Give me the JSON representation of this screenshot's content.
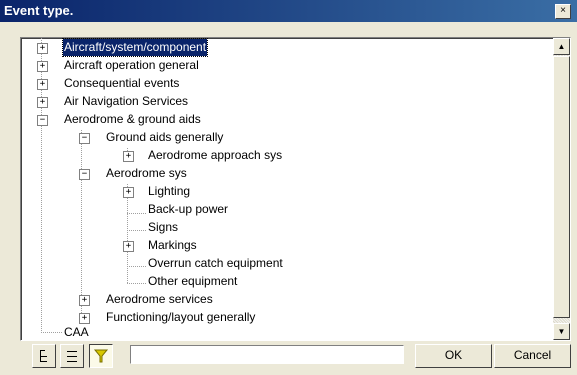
{
  "window": {
    "title": "Event type.",
    "close_glyph": "×"
  },
  "tree": {
    "nodes": [
      {
        "label": "Aircraft/system/component",
        "expander": "+",
        "selected": true
      },
      {
        "label": "Aircraft operation general",
        "expander": "+"
      },
      {
        "label": "Consequential events",
        "expander": "+"
      },
      {
        "label": "Air Navigation Services",
        "expander": "+"
      },
      {
        "label": "Aerodrome & ground aids",
        "expander": "−"
      },
      {
        "label": "Ground aids generally",
        "expander": "−"
      },
      {
        "label": "Aerodrome approach sys",
        "expander": "+"
      },
      {
        "label": "Aerodrome sys",
        "expander": "−"
      },
      {
        "label": "Lighting",
        "expander": "+"
      },
      {
        "label": "Back-up power",
        "expander": ""
      },
      {
        "label": "Signs",
        "expander": ""
      },
      {
        "label": "Markings",
        "expander": "+"
      },
      {
        "label": "Overrun catch equipment",
        "expander": ""
      },
      {
        "label": "Other equipment",
        "expander": ""
      },
      {
        "label": "Aerodrome services",
        "expander": "+"
      },
      {
        "label": "Functioning/layout generally",
        "expander": "+"
      },
      {
        "label": "CAA",
        "expander": ""
      }
    ]
  },
  "scrollbar": {
    "up_glyph": "▲",
    "down_glyph": "▼"
  },
  "toolbar": {
    "buttons": [
      {
        "icon": "tree-view-icon"
      },
      {
        "icon": "list-view-icon"
      },
      {
        "icon": "filter-icon",
        "pressed": true
      }
    ],
    "filter_value": ""
  },
  "actions": {
    "ok_label": "OK",
    "cancel_label": "Cancel"
  },
  "colors": {
    "selection": "#0a246a",
    "titlebar": "#0a246a",
    "filter_accent": "#d7c800"
  }
}
